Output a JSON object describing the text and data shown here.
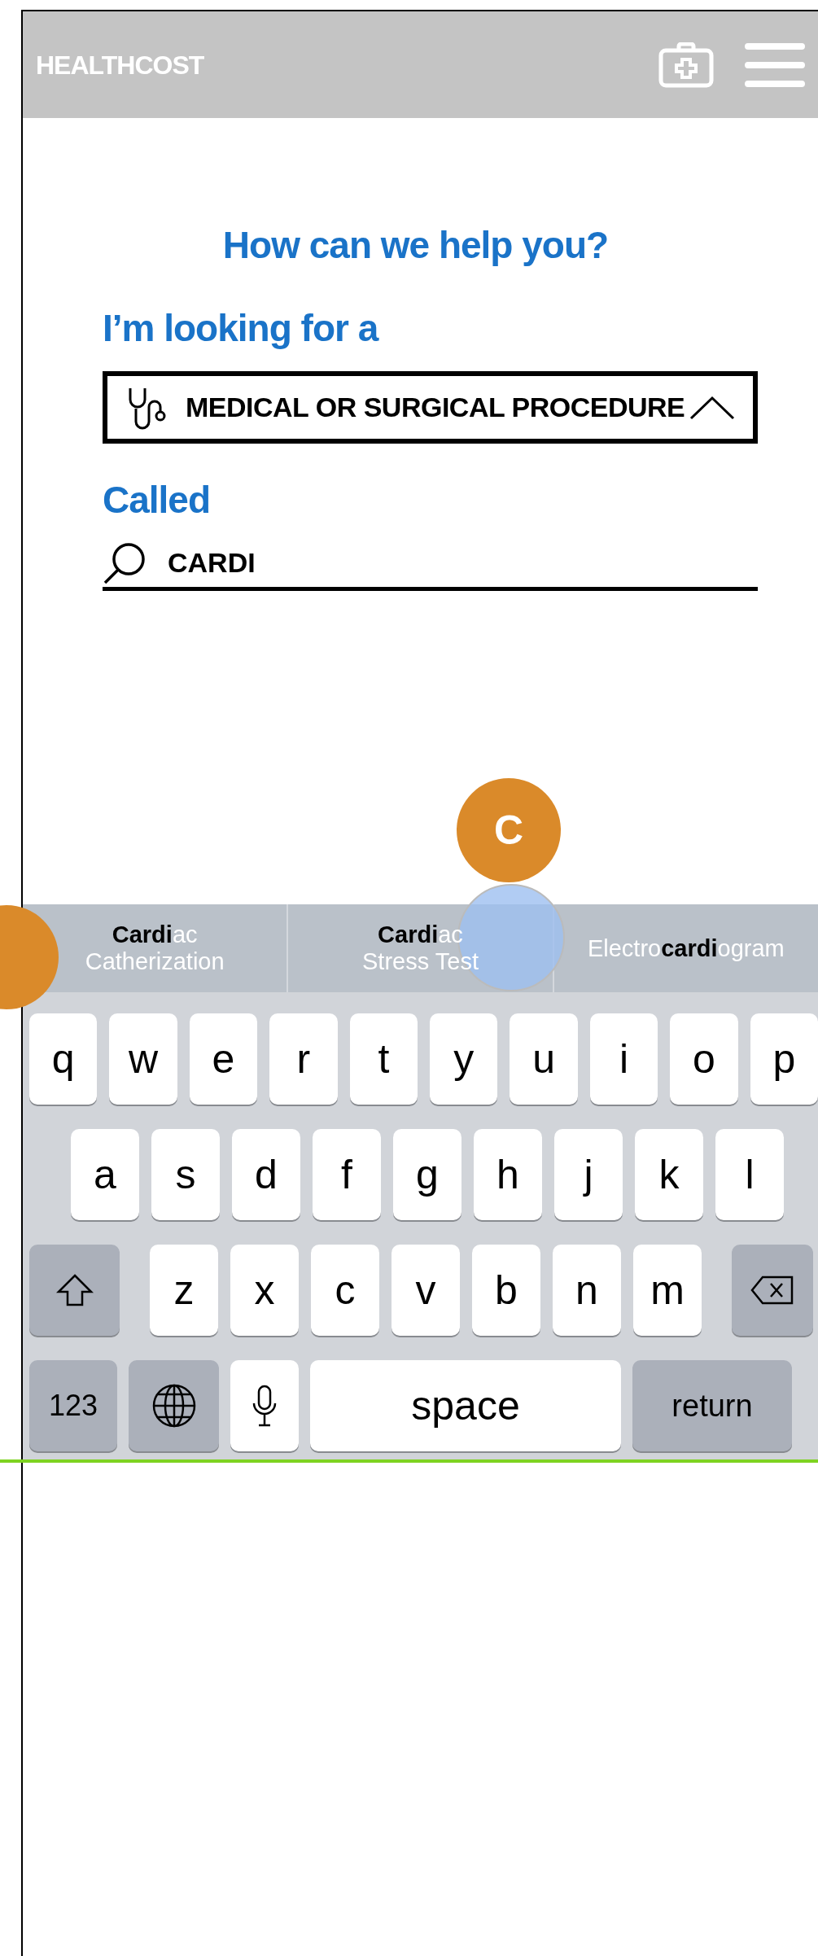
{
  "header": {
    "brand": "HEALTHCOST"
  },
  "heading": "How can we help you?",
  "looking_label": "I’m looking for a",
  "category_select": {
    "value": "MEDICAL OR SURGICAL PROCEDURE",
    "expanded": true
  },
  "called_label": "Called",
  "search": {
    "value": "CARDI"
  },
  "marker": {
    "label": "C"
  },
  "suggestions": [
    {
      "lines": [
        "**Cardi**ac",
        "Catherization"
      ]
    },
    {
      "lines": [
        "**Cardi**ac",
        "Stress Test"
      ]
    },
    {
      "lines": [
        "Electro**cardi**ogram"
      ]
    }
  ],
  "keyboard": {
    "rows": [
      [
        "q",
        "w",
        "e",
        "r",
        "t",
        "y",
        "u",
        "i",
        "o",
        "p"
      ],
      [
        "a",
        "s",
        "d",
        "f",
        "g",
        "h",
        "j",
        "k",
        "l"
      ],
      [
        "z",
        "x",
        "c",
        "v",
        "b",
        "n",
        "m"
      ]
    ],
    "numbers_key": "123",
    "space_key": "space",
    "return_key": "return"
  }
}
